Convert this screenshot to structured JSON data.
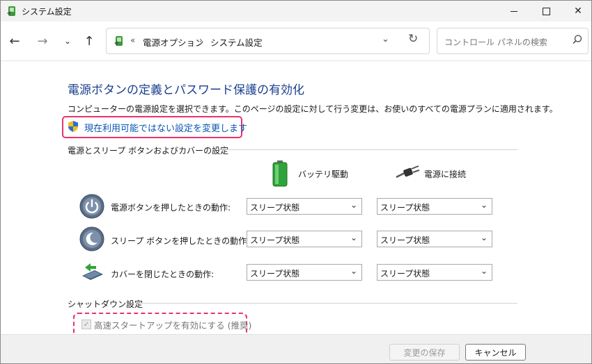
{
  "window": {
    "title": "システム設定",
    "minimize_symbol": "",
    "close_symbol": "✕"
  },
  "nav": {
    "back": "←",
    "forward": "→",
    "history": "⌄",
    "up": "↑",
    "address_prefix": "«",
    "breadcrumb": [
      "電源オプション",
      "システム設定"
    ],
    "separator": "›",
    "dropdown": "⌄",
    "refresh": "↻",
    "search_placeholder": "コントロール パネルの検索"
  },
  "content": {
    "title": "電源ボタンの定義とパスワード保護の有効化",
    "description": "コンピューターの電源設定を選択できます。このページの設定に対して行う変更は、お使いのすべての電源プランに適用されます。",
    "change_link": "現在利用可能ではない設定を変更します",
    "section_power": "電源とスリープ ボタンおよびカバーの設定",
    "col_battery": "バッテリ駆動",
    "col_plugged": "電源に接続",
    "rows": [
      {
        "label": "電源ボタンを押したときの動作:",
        "battery": "スリープ状態",
        "plugged": "スリープ状態"
      },
      {
        "label": "スリープ ボタンを押したときの動作:",
        "battery": "スリープ状態",
        "plugged": "スリープ状態"
      },
      {
        "label": "カバーを閉じたときの動作:",
        "battery": "スリープ状態",
        "plugged": "スリープ状態"
      }
    ],
    "section_shutdown": "シャットダウン設定",
    "fast_startup": "高速スタートアップを有効にする (推奨)",
    "fast_startup_checked": true
  },
  "footer": {
    "save": "変更の保存",
    "cancel": "キャンセル"
  },
  "colors": {
    "title_blue": "#1a3f8f",
    "link_blue": "#0a54b4",
    "highlight": "#e8336b"
  }
}
